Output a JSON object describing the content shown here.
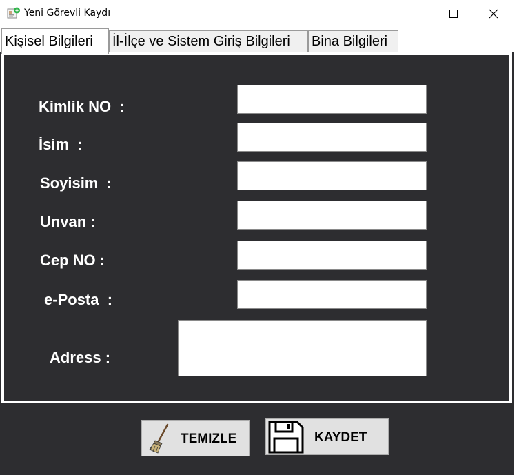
{
  "window": {
    "title": "Yeni Görevli Kaydı",
    "icons": {
      "app": "user-add-icon",
      "minimize": "minimize-icon",
      "maximize": "maximize-icon",
      "close": "close-icon"
    }
  },
  "tabs": [
    {
      "label": "Kişisel Bilgileri",
      "active": true
    },
    {
      "label": "İl-İlçe ve Sistem Giriş Bilgileri",
      "active": false
    },
    {
      "label": "Bina Bilgileri",
      "active": false
    }
  ],
  "form": {
    "kimlik_label": "Kimlik NO  :",
    "isim_label": "İsim  :",
    "soyisim_label": "Soyisim  :",
    "unvan_label": "Unvan :",
    "cep_label": "Cep NO :",
    "eposta_label": "e-Posta  :",
    "adres_label": "Adress :",
    "kimlik_value": "",
    "isim_value": "",
    "soyisim_value": "",
    "unvan_value": "",
    "cep_value": "",
    "eposta_value": "",
    "adres_value": ""
  },
  "buttons": {
    "temizle_label": "TEMIZLE",
    "temizle_icon": "broom-icon",
    "kaydet_label": "KAYDET",
    "kaydet_icon": "floppy-disk-icon"
  },
  "colors": {
    "form_background": "#2d2d30",
    "label_text": "#ffffff",
    "button_face": "#e1e1e1"
  }
}
